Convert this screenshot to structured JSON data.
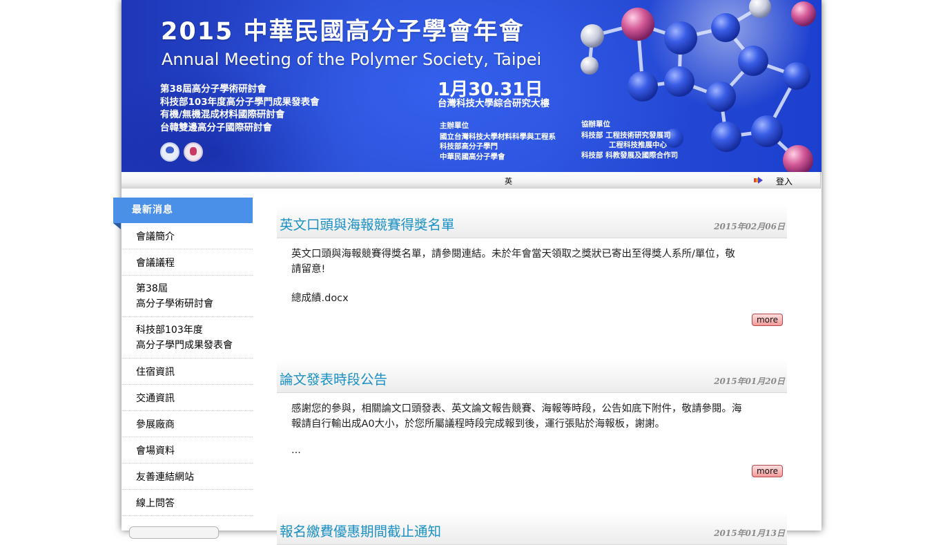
{
  "banner": {
    "title": "2015 中華民國高分子學會年會",
    "subtitle": "Annual Meeting of the Polymer Society, Taipei",
    "events": [
      "第38屆高分子學術研討會",
      "科技部103年度高分子學門成果發表會",
      "有機/無機混成材料國際研討會",
      "台韓雙邊高分子國際研討會"
    ],
    "date": "1月30.31日",
    "venue": "台灣科技大學綜合研究大樓",
    "organizer_heading": "主辦單位",
    "organizers": [
      "國立台灣科技大學材料科學與工程系",
      "科技部高分子學門",
      "中華民國高分子學會"
    ],
    "co_organizer_heading": "協辦單位",
    "co_organizers": [
      "科技部 工程技術研究發展司",
      "工程科技推展中心",
      "科技部 科教發展及國際合作司"
    ]
  },
  "topbar": {
    "lang": "英",
    "login": "登入",
    "login_icon": "arrow-login-icon"
  },
  "sidebar": {
    "active": "最新消息",
    "items": [
      {
        "label": "會議簡介"
      },
      {
        "label": "會議議程"
      },
      {
        "line1": "第38屆",
        "line2": "高分子學術研討會"
      },
      {
        "line1": "科技部103年度",
        "line2": "高分子學門成果發表會"
      },
      {
        "label": "住宿資訊"
      },
      {
        "label": "交通資訊"
      },
      {
        "label": "參展廠商"
      },
      {
        "label": "會場資料"
      },
      {
        "label": "友善連結網站"
      },
      {
        "label": "線上問答"
      }
    ]
  },
  "posts": [
    {
      "title": "英文口頭與海報競賽得獎名單",
      "date": "2015年02月06日",
      "body_line1": "英文口頭與海報競賽得獎名單，請參閱連結。未於年會當天領取之獎狀已寄出至得獎人系所/單位，敬",
      "body_line2": "請留意!",
      "attachment": "總成績.docx",
      "more": "more"
    },
    {
      "title": "論文發表時段公告",
      "date": "2015年01月20日",
      "body_line1": "感謝您的參與，相關論文口頭發表、英文論文報告競賽、海報等時段，公告如底下附件，敬請參閱。海",
      "body_line2": "報請自行輸出成A0大小，於您所屬議程時段完成報到後，運行張貼於海報板，謝謝。",
      "ellipsis": "...",
      "more": "more"
    },
    {
      "title": "報名繳費優惠期間截止通知",
      "date": "2015年01月13日"
    }
  ],
  "colors": {
    "banner_blue": "#2b4fd6",
    "sidebar_active": "#4a8fe8",
    "post_title": "#1a90c4",
    "more_button": "#f39a9a"
  }
}
